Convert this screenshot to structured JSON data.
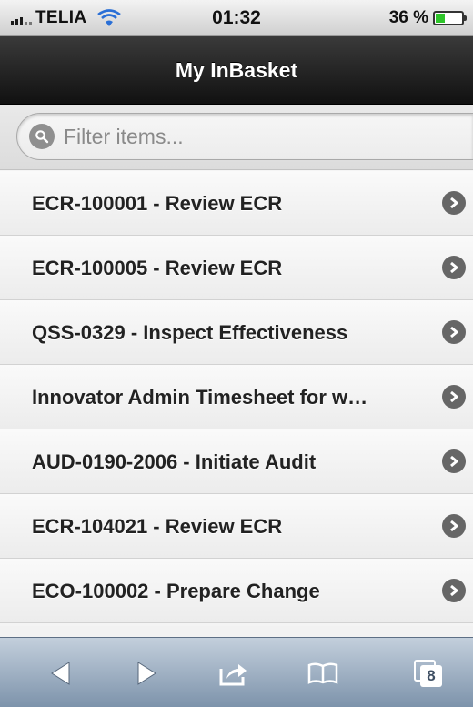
{
  "status_bar": {
    "carrier": "TELIA",
    "time": "01:32",
    "battery_percent": "36 %",
    "battery_level": 0.36,
    "signal_bars": 3
  },
  "nav": {
    "title": "My InBasket"
  },
  "search": {
    "placeholder": "Filter items...",
    "value": ""
  },
  "items": [
    {
      "label": "ECR-100001 - Review ECR"
    },
    {
      "label": "ECR-100005 - Review ECR"
    },
    {
      "label": "QSS-0329 - Inspect Effectiveness"
    },
    {
      "label": "Innovator Admin Timesheet for w…"
    },
    {
      "label": "AUD-0190-2006 - Initiate Audit"
    },
    {
      "label": "ECR-104021 - Review ECR"
    },
    {
      "label": "ECO-100002 - Prepare Change"
    }
  ],
  "toolbar": {
    "tabs_count": "8",
    "icons": [
      "back-icon",
      "forward-icon",
      "share-icon",
      "bookmarks-icon",
      "tabs-icon"
    ]
  },
  "colors": {
    "nav_bg": "#1a1a1a",
    "toolbar_bg": "#8da0b6",
    "battery_green": "#2ec52a"
  }
}
